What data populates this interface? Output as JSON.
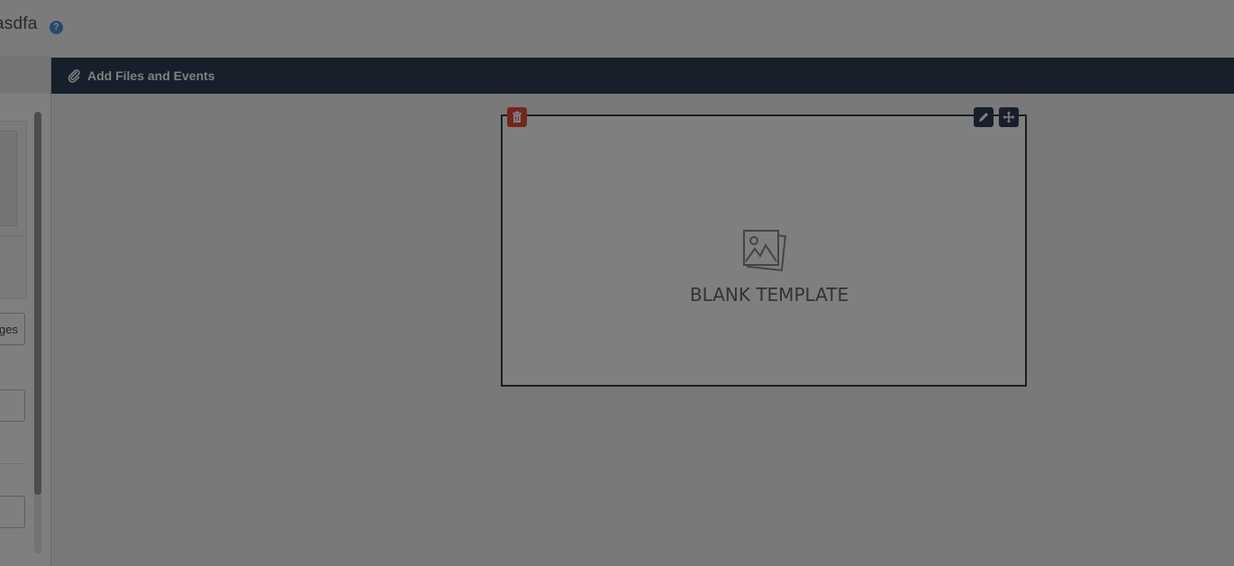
{
  "header": {
    "title": "asdfa",
    "help_icon": "question-circle-icon"
  },
  "left_panel": {
    "input_partial_text": "ges"
  },
  "main": {
    "header_label": "Add Files and Events",
    "header_icon": "paperclip-icon",
    "template": {
      "label": "BLANK TEMPLATE",
      "placeholder_icon": "image-stack-icon",
      "controls": {
        "delete_icon": "trash-icon",
        "edit_icon": "pencil-icon",
        "move_icon": "move-arrows-icon"
      }
    }
  },
  "colors": {
    "header_dark": "#2c3e55",
    "delete_red": "#e74c3c",
    "help_blue": "#4a90d9",
    "backdrop": "rgba(0,0,0,0.5)"
  }
}
